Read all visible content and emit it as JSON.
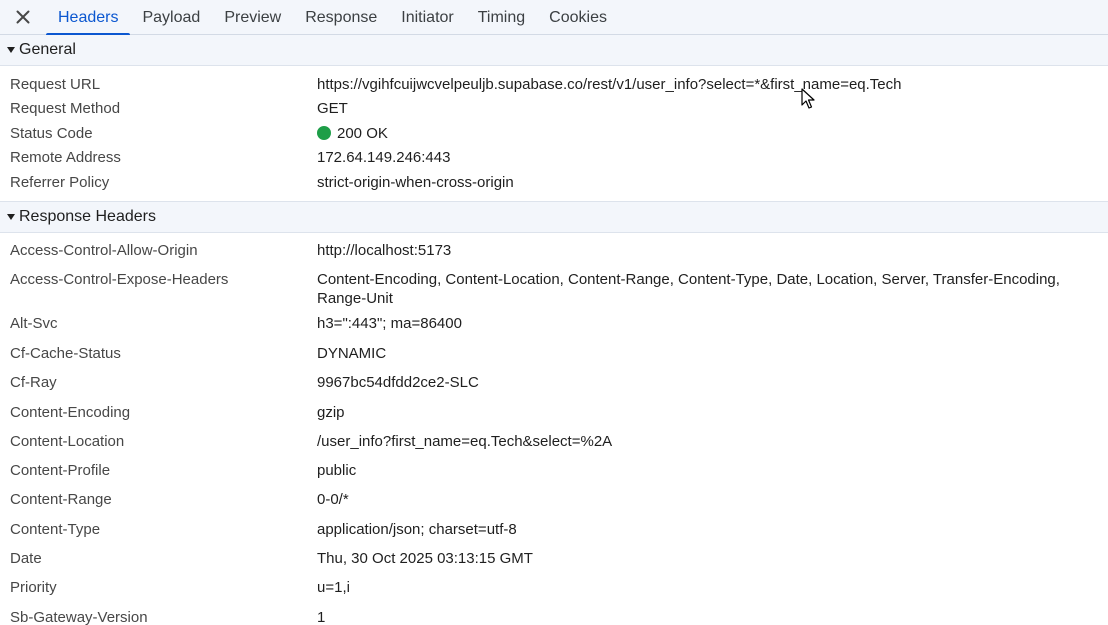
{
  "tabs": {
    "close_label": "×",
    "items": [
      {
        "label": "Headers",
        "active": true
      },
      {
        "label": "Payload"
      },
      {
        "label": "Preview"
      },
      {
        "label": "Response"
      },
      {
        "label": "Initiator"
      },
      {
        "label": "Timing"
      },
      {
        "label": "Cookies"
      }
    ]
  },
  "general": {
    "title": "General",
    "rows": [
      {
        "key": "Request URL",
        "value": "https://vgihfcuijwcvelpeuljb.supabase.co/rest/v1/user_info?select=*&first_name=eq.Tech"
      },
      {
        "key": "Request Method",
        "value": "GET"
      },
      {
        "key": "Status Code",
        "value": "200 OK",
        "status_color": "#1e9e48"
      },
      {
        "key": "Remote Address",
        "value": "172.64.149.246:443"
      },
      {
        "key": "Referrer Policy",
        "value": "strict-origin-when-cross-origin"
      }
    ]
  },
  "response_headers": {
    "title": "Response Headers",
    "rows": [
      {
        "key": "Access-Control-Allow-Origin",
        "value": "http://localhost:5173"
      },
      {
        "key": "Access-Control-Expose-Headers",
        "value": "Content-Encoding, Content-Location, Content-Range, Content-Type, Date, Location, Server, Transfer-Encoding, Range-Unit"
      },
      {
        "key": "Alt-Svc",
        "value": "h3=\":443\"; ma=86400"
      },
      {
        "key": "Cf-Cache-Status",
        "value": "DYNAMIC"
      },
      {
        "key": "Cf-Ray",
        "value": "9967bc54dfdd2ce2-SLC"
      },
      {
        "key": "Content-Encoding",
        "value": "gzip"
      },
      {
        "key": "Content-Location",
        "value": "/user_info?first_name=eq.Tech&select=%2A"
      },
      {
        "key": "Content-Profile",
        "value": "public"
      },
      {
        "key": "Content-Range",
        "value": "0-0/*"
      },
      {
        "key": "Content-Type",
        "value": "application/json; charset=utf-8"
      },
      {
        "key": "Date",
        "value": "Thu, 30 Oct 2025 03:13:15 GMT"
      },
      {
        "key": "Priority",
        "value": "u=1,i"
      },
      {
        "key": "Sb-Gateway-Version",
        "value": "1"
      }
    ]
  },
  "colors": {
    "accent": "#0b57d0",
    "section_bg": "#f3f6fb",
    "status_ok": "#1e9e48"
  }
}
